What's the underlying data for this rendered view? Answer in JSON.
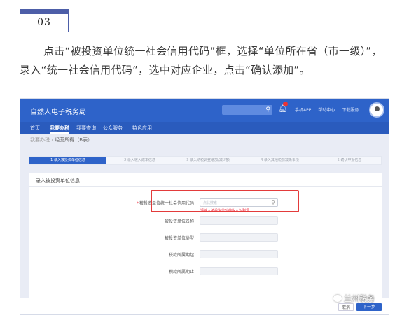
{
  "step_number": "03",
  "instruction": "点击“被投资单位统一社会信用代码”框，选择“单位所在省（市一级）”，录入“统一社会信用代码”，选中对应企业，点击“确认添加”。",
  "app": {
    "title": "自然人电子税务局",
    "header_links": [
      "手机APP",
      "帮助中心",
      "下载服务"
    ],
    "nav": [
      "首页",
      "我要办税",
      "我要查询",
      "公众服务",
      "特色应用"
    ],
    "nav_active_index": 1,
    "breadcrumb": [
      "我要办税",
      "经营所得（B表）"
    ],
    "steps": [
      "1 录入被投资单位信息",
      "2 录入收入成本信息",
      "3 录入纳税调整增加/减少额",
      "4 录入其他税前减免事项",
      "5 确认申报信息"
    ],
    "active_step": 0,
    "panel_title": "录入被投资单位信息",
    "form": {
      "credit_code_label": "被投资单位统一社会信用代码",
      "credit_code_placeholder": "点此搜索",
      "credit_code_hint": "请输入被投资单位纳税人识别号",
      "name_label": "被投资单位名称",
      "type_label": "被投资单位类型",
      "period_start_label": "税款所属期起",
      "period_end_label": "税款所属期止"
    },
    "buttons": {
      "cancel": "取消",
      "next": "下一步"
    }
  },
  "watermark": "兰州税务",
  "colors": {
    "accent": "#2e63c9",
    "highlight": "#e33b3b",
    "badge": "#4d5ea8"
  }
}
